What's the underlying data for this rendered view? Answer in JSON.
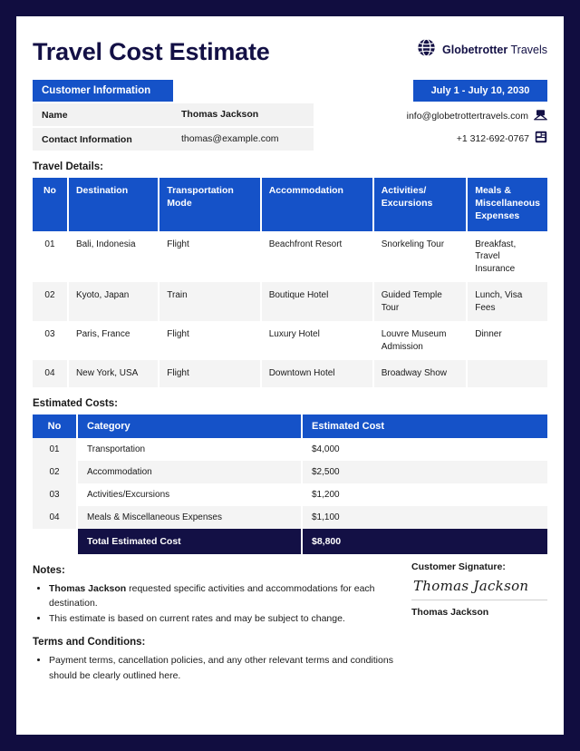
{
  "document": {
    "title": "Travel Cost Estimate",
    "brand_name_bold": "Globetrotter",
    "brand_name_light": " Travels",
    "logo_icon": "globe-icon"
  },
  "customer": {
    "section_label": "Customer Information",
    "rows": [
      {
        "label": "Name",
        "value": "Thomas Jackson"
      },
      {
        "label": "Contact Information",
        "value": "thomas@example.com"
      }
    ]
  },
  "contact": {
    "date_range": "July 1 - July 10, 2030",
    "email": "info@globetrottertravels.com",
    "email_icon": "envelope-icon",
    "phone": "+1 312-692-0767",
    "phone_icon": "telephone-icon"
  },
  "travel_details": {
    "title": "Travel Details:",
    "columns": [
      "No",
      "Destination",
      "Transportation Mode",
      "Accommodation",
      "Activities/ Excursions",
      "Meals & Miscellaneous Expenses"
    ],
    "rows": [
      {
        "no": "01",
        "destination": "Bali, Indonesia",
        "transportation": "Flight",
        "accommodation": "Beachfront Resort",
        "activities": "Snorkeling Tour",
        "meals": "Breakfast, Travel Insurance"
      },
      {
        "no": "02",
        "destination": "Kyoto, Japan",
        "transportation": "Train",
        "accommodation": "Boutique Hotel",
        "activities": "Guided Temple Tour",
        "meals": "Lunch, Visa Fees"
      },
      {
        "no": "03",
        "destination": "Paris, France",
        "transportation": "Flight",
        "accommodation": "Luxury Hotel",
        "activities": "Louvre Museum Admission",
        "meals": "Dinner"
      },
      {
        "no": "04",
        "destination": "New York, USA",
        "transportation": "Flight",
        "accommodation": "Downtown Hotel",
        "activities": "Broadway Show",
        "meals": ""
      }
    ]
  },
  "estimated_costs": {
    "title": "Estimated Costs:",
    "columns": [
      "No",
      "Category",
      "Estimated Cost"
    ],
    "rows": [
      {
        "no": "01",
        "category": "Transportation",
        "cost": "$4,000"
      },
      {
        "no": "02",
        "category": "Accommodation",
        "cost": "$2,500"
      },
      {
        "no": "03",
        "category": "Activities/Excursions",
        "cost": "$1,200"
      },
      {
        "no": "04",
        "category": "Meals & Miscellaneous Expenses",
        "cost": "$1,100"
      }
    ],
    "total_label": "Total Estimated Cost",
    "total_value": "$8,800"
  },
  "notes": {
    "title": "Notes:",
    "items": [
      {
        "bold_prefix": "Thomas Jackson",
        "text": " requested specific activities and accommodations for each destination."
      },
      {
        "bold_prefix": "",
        "text": "This estimate is based on current rates and may be subject to change."
      }
    ]
  },
  "terms": {
    "title": "Terms and Conditions:",
    "items": [
      "Payment terms, cancellation policies, and any other relevant terms and conditions should be clearly outlined here."
    ]
  },
  "signature": {
    "label": "Customer Signature:",
    "script": "Thomas Jackson",
    "name": "Thomas Jackson"
  },
  "colors": {
    "navy": "#131045",
    "blue": "#1552c8",
    "row_alt": "#f4f4f4"
  }
}
